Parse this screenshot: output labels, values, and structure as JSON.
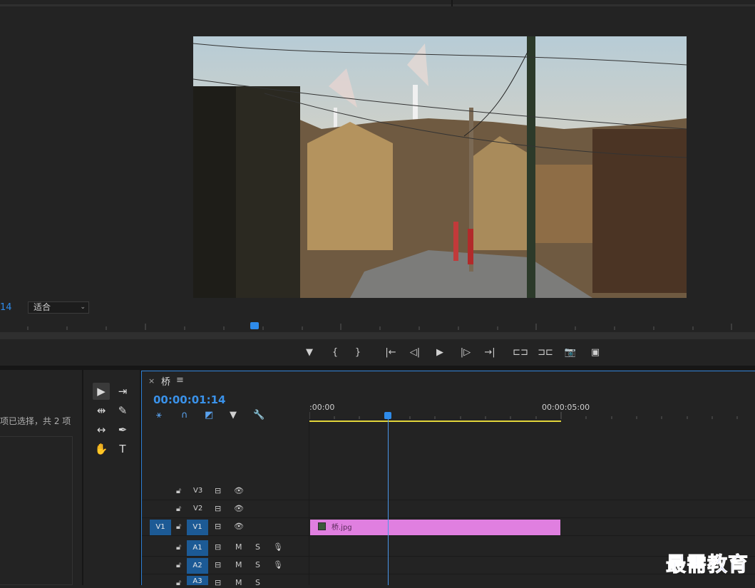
{
  "monitor": {
    "zoom_partial": "14",
    "fit_option": "适合",
    "controls": [
      {
        "icon": "marker-icon",
        "glyph": "▼"
      },
      {
        "icon": "mark-in-icon",
        "glyph": "{"
      },
      {
        "icon": "mark-out-icon",
        "glyph": "}"
      },
      {
        "icon": "go-to-in-icon",
        "glyph": "|←"
      },
      {
        "icon": "step-back-icon",
        "glyph": "◁|"
      },
      {
        "icon": "play-icon",
        "glyph": "▶"
      },
      {
        "icon": "step-forward-icon",
        "glyph": "|▷"
      },
      {
        "icon": "go-to-out-icon",
        "glyph": "→|"
      },
      {
        "icon": "lift-icon",
        "glyph": "⊏⊐"
      },
      {
        "icon": "extract-icon",
        "glyph": "⊐⊏"
      },
      {
        "icon": "camera-icon",
        "glyph": "📷"
      },
      {
        "icon": "compare-icon",
        "glyph": "▣"
      }
    ]
  },
  "project": {
    "selection_text": "项已选择，共 2 项"
  },
  "tools": [
    {
      "icon": "selection-tool-icon",
      "glyph": "▶"
    },
    {
      "icon": "track-select-icon",
      "glyph": "⇥"
    },
    {
      "icon": "ripple-edit-icon",
      "glyph": "⇹"
    },
    {
      "icon": "razor-icon",
      "glyph": "✎"
    },
    {
      "icon": "slip-icon",
      "glyph": "↔"
    },
    {
      "icon": "pen-icon",
      "glyph": "✒"
    },
    {
      "icon": "hand-icon",
      "glyph": "✋"
    },
    {
      "icon": "type-icon",
      "glyph": "T"
    }
  ],
  "timeline": {
    "close": "×",
    "tab_title": "桥",
    "menu": "≡",
    "timecode": "00:00:01:14",
    "ruler_start": ":00:00",
    "ruler_mid": "00:00:05:00",
    "icons": [
      {
        "icon": "nest-icon",
        "glyph": "⚹"
      },
      {
        "icon": "snap-icon",
        "glyph": "∩"
      },
      {
        "icon": "linked-selection-icon",
        "glyph": "◩"
      },
      {
        "icon": "add-marker-icon",
        "glyph": "▼"
      },
      {
        "icon": "settings-wrench-icon",
        "glyph": "🔧"
      }
    ],
    "tracks": {
      "v3": {
        "name": "V3"
      },
      "v2": {
        "name": "V2"
      },
      "v1": {
        "source": "V1",
        "name": "V1"
      },
      "a1": {
        "name": "A1",
        "mute": "M",
        "solo": "S"
      },
      "a2": {
        "name": "A2",
        "mute": "M",
        "solo": "S"
      },
      "a3": {
        "name": "A3",
        "mute": "M",
        "solo": "S"
      }
    },
    "clip_label": "桥.jpg"
  },
  "watermark": "最需教育"
}
